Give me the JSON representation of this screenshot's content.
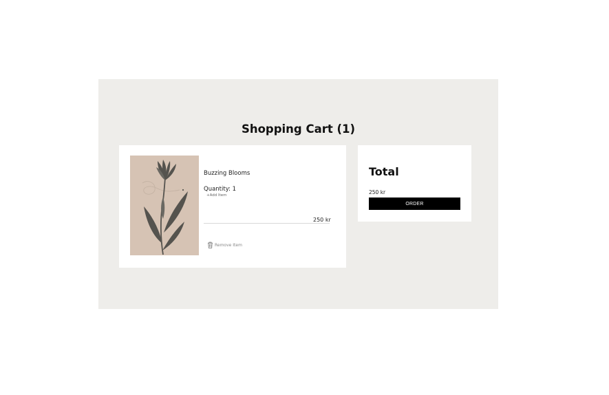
{
  "cart": {
    "title": "Shopping Cart (1)",
    "items": [
      {
        "name": "Buzzing Blooms",
        "quantity_label": "Quantity: 1",
        "add_item_label": "+Add Item",
        "price": "250 kr",
        "remove_label": "Remove Item",
        "image_alt": "Botanical print"
      }
    ]
  },
  "summary": {
    "title": "Total",
    "amount": "250 kr",
    "order_label": "ORDER"
  },
  "colors": {
    "panel_background": "#eeedea",
    "image_background": "#d6c3b4",
    "leaf": "#55534e",
    "button": "#000000"
  },
  "icons": {
    "remove": "trash-icon"
  }
}
